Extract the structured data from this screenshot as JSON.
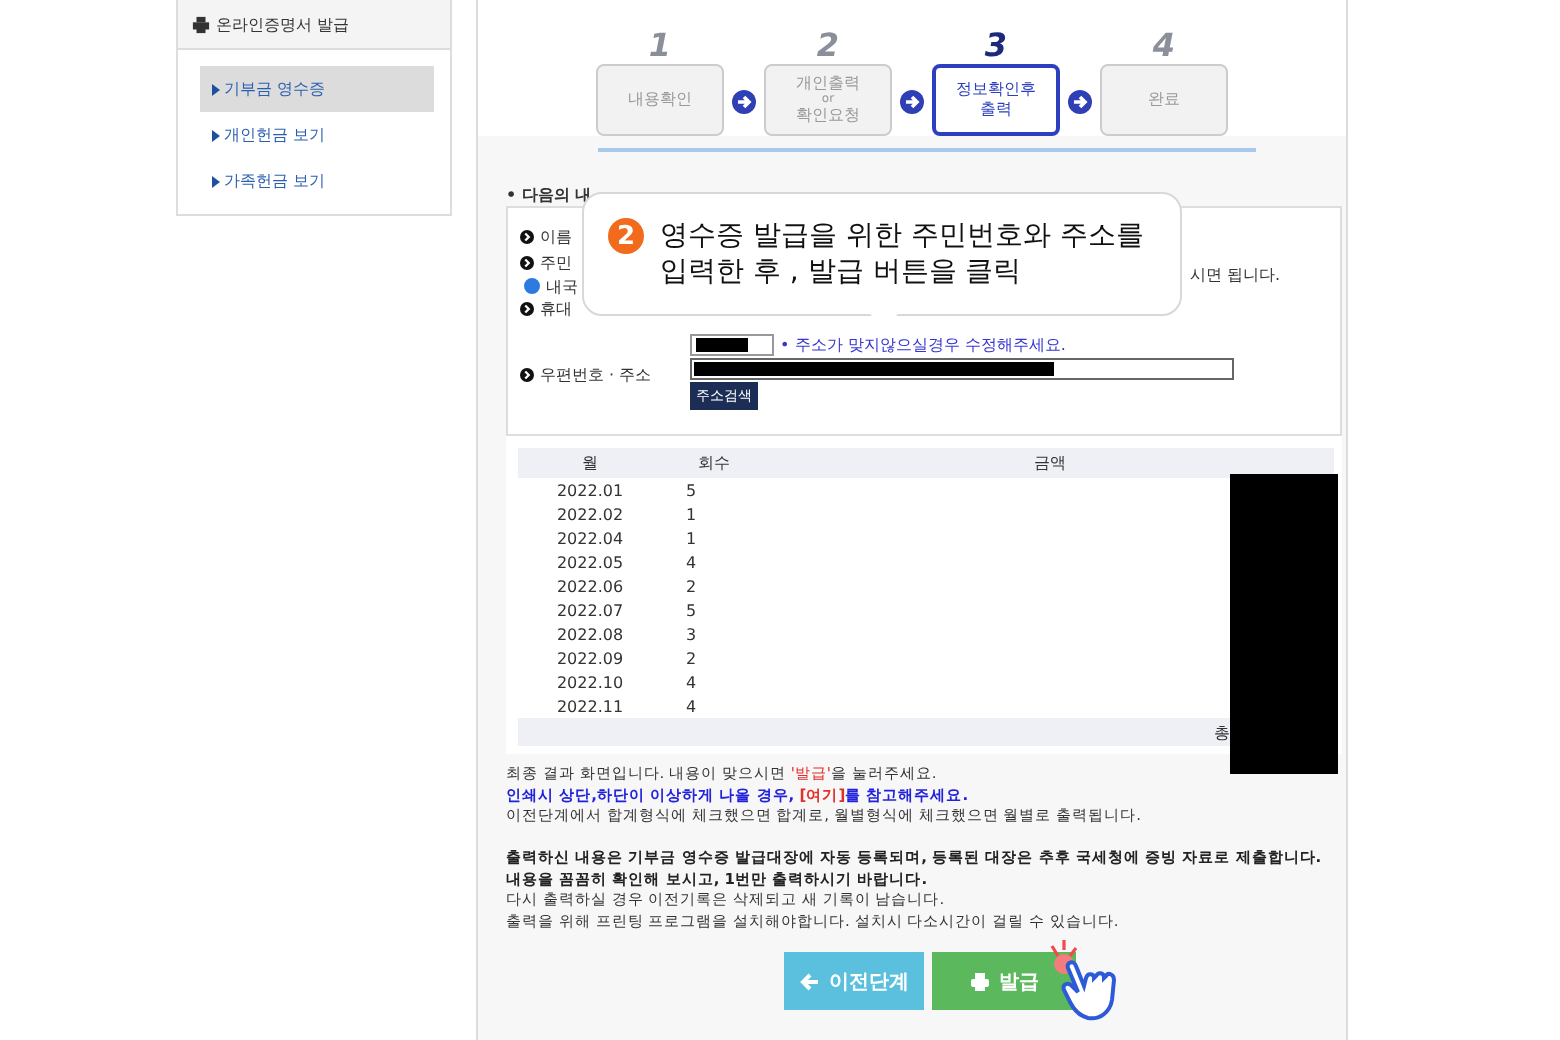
{
  "sidebar": {
    "title": "온라인증명서 발급",
    "items": [
      {
        "label": "기부금  영수증",
        "selected": true
      },
      {
        "label": "개인헌금  보기",
        "selected": false
      },
      {
        "label": "가족헌금  보기",
        "selected": false
      }
    ]
  },
  "steps": [
    {
      "number": "1",
      "lines": [
        "내용확인"
      ],
      "selected": false
    },
    {
      "number": "2",
      "lines": [
        "개인출력",
        "or",
        "확인요청"
      ],
      "selected": false
    },
    {
      "number": "3",
      "lines": [
        "정보확인후",
        "출력"
      ],
      "selected": true
    },
    {
      "number": "4",
      "lines": [
        "완료"
      ],
      "selected": false
    }
  ],
  "form": {
    "heading": "• 다음의 내",
    "labels": [
      "이름",
      "주민"
    ],
    "radio": {
      "label": "내국",
      "selected": true
    },
    "phone_label": "휴대",
    "right_note": "시면 됩니다.",
    "zip_hint": "• 주소가 맞지않으실경우 수정해주세요.",
    "address_label": "우편번호 · 주소",
    "search_button": "주소검색"
  },
  "callout": {
    "badge": "2",
    "text": "영수증 발급을 위한 주민번호와 주소를\n입력한 후 , 발급 버튼을 클릭"
  },
  "table": {
    "columns": [
      "월",
      "회수",
      "금액"
    ],
    "rows": [
      [
        "2022.01",
        "5"
      ],
      [
        "2022.02",
        "1"
      ],
      [
        "2022.04",
        "1"
      ],
      [
        "2022.05",
        "4"
      ],
      [
        "2022.06",
        "2"
      ],
      [
        "2022.07",
        "5"
      ],
      [
        "2022.08",
        "3"
      ],
      [
        "2022.09",
        "2"
      ],
      [
        "2022.10",
        "4"
      ],
      [
        "2022.11",
        "4"
      ]
    ],
    "total_label": "총"
  },
  "notes": [
    {
      "lines": [
        {
          "segments": [
            {
              "kind": "plain",
              "text": "최종 결과 화면입니다. 내용이 맞으시면 "
            },
            {
              "kind": "red",
              "text": "'발급'"
            },
            {
              "kind": "plain",
              "text": "을 눌러주세요."
            }
          ]
        },
        {
          "segments": [
            {
              "kind": "blue",
              "text": "인쇄시 상단,하단이 이상하게 나올 경우, "
            },
            {
              "kind": "redbold",
              "text": "[여기]"
            },
            {
              "kind": "blue",
              "text": "를 참고해주세요."
            }
          ]
        },
        {
          "segments": [
            {
              "kind": "plain",
              "text": "이전단계에서 합계형식에 체크했으면 합계로, 월별형식에 체크했으면 월별로 출력됩니다."
            }
          ]
        }
      ]
    },
    {
      "lines": [
        {
          "segments": [
            {
              "kind": "bold",
              "text": "출력하신 내용은 기부금 영수증 발급대장에 자동 등록되며, 등록된 대장은 추후 국세청에 증빙 자료로 제출합니다."
            }
          ]
        },
        {
          "segments": [
            {
              "kind": "bold",
              "text": "내용을 꼼꼼히 확인해 보시고, 1번만 출력하시기 바랍니다."
            }
          ]
        },
        {
          "segments": [
            {
              "kind": "plain",
              "text": "다시 출력하실 경우 이전기록은 삭제되고 새 기록이 남습니다."
            }
          ]
        },
        {
          "segments": [
            {
              "kind": "plain",
              "text": "출력을 위해 프린팅 프로그램을 설치해야합니다. 설치시 다소시간이 걸릴 수 있습니다."
            }
          ]
        }
      ]
    }
  ],
  "buttons": [
    {
      "kind": "back",
      "label": "이전단계"
    },
    {
      "kind": "issue",
      "label": "발급"
    }
  ]
}
